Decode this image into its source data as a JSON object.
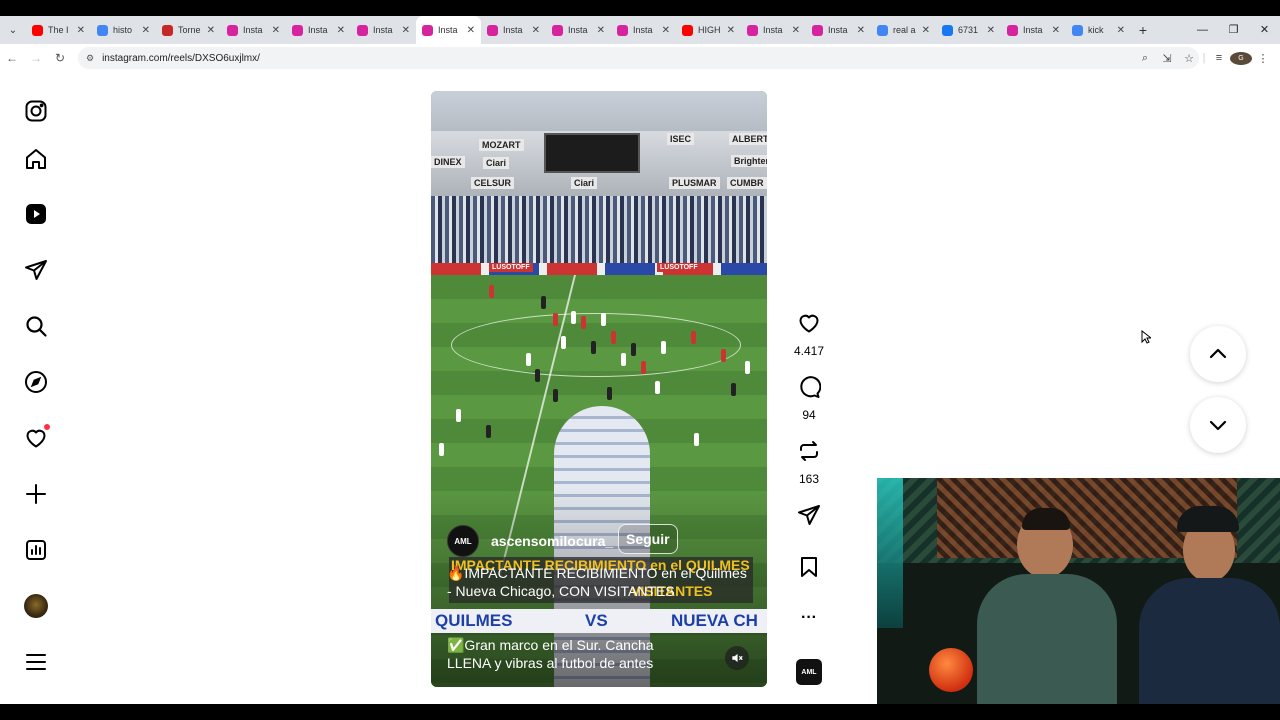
{
  "browser": {
    "tabs": [
      {
        "label": "The I",
        "icon": "youtube-icon",
        "color": "#ff0000"
      },
      {
        "label": "histo",
        "icon": "google-icon",
        "color": "#4285f4"
      },
      {
        "label": "Torne",
        "icon": "page-icon",
        "color": "#c62828"
      },
      {
        "label": "Insta",
        "icon": "instagram-icon",
        "color": "#d6249f"
      },
      {
        "label": "Insta",
        "icon": "instagram-icon",
        "color": "#d6249f"
      },
      {
        "label": "Insta",
        "icon": "instagram-icon",
        "color": "#d6249f"
      },
      {
        "label": "Insta",
        "icon": "instagram-icon",
        "color": "#d6249f",
        "active": true
      },
      {
        "label": "Insta",
        "icon": "instagram-icon",
        "color": "#d6249f"
      },
      {
        "label": "Insta",
        "icon": "instagram-icon",
        "color": "#d6249f"
      },
      {
        "label": "Insta",
        "icon": "instagram-icon",
        "color": "#d6249f"
      },
      {
        "label": "HIGH",
        "icon": "youtube-icon",
        "color": "#ff0000"
      },
      {
        "label": "Insta",
        "icon": "instagram-icon",
        "color": "#d6249f"
      },
      {
        "label": "Insta",
        "icon": "instagram-icon",
        "color": "#d6249f"
      },
      {
        "label": "real a",
        "icon": "google-icon",
        "color": "#4285f4"
      },
      {
        "label": "6731",
        "icon": "facebook-icon",
        "color": "#1877f2"
      },
      {
        "label": "Insta",
        "icon": "instagram-icon",
        "color": "#d6249f"
      },
      {
        "label": "kick",
        "icon": "google-icon",
        "color": "#4285f4"
      }
    ],
    "url": "instagram.com/reels/DXSO6uxjlmx/",
    "new_tab": "+",
    "profile_initial": "G"
  },
  "reel": {
    "author": "ascensomilocura_",
    "author_badge": "AML",
    "follow": "Seguir",
    "caption_line1": "🔥IMPACTANTE RECIBIMIENTO en el Quilmes - Nueva Chicago, CON VISITANTES",
    "caption_line2": "✅Gran marco en el Sur. Cancha LLENA y vibras al futbol de antes",
    "banner_top": "IMPACTANTE RECIBIMIENTO en el QUILMES",
    "banner_mid": "VISITANTES",
    "vs_left": "QUILMES",
    "vs": "VS",
    "vs_right": "NUEVA CH",
    "ads": [
      "MOZART",
      "Ciari",
      "DINEX",
      "CELSUR",
      "Ciari",
      "ISEC",
      "ALBERTO",
      "PLUSMAR",
      "CUMBR",
      "Brighter",
      "LUSOTOFF",
      "LUSOTOFF"
    ]
  },
  "actions": {
    "likes": "4.417",
    "comments": "94",
    "reposts": "163",
    "more": "···"
  }
}
